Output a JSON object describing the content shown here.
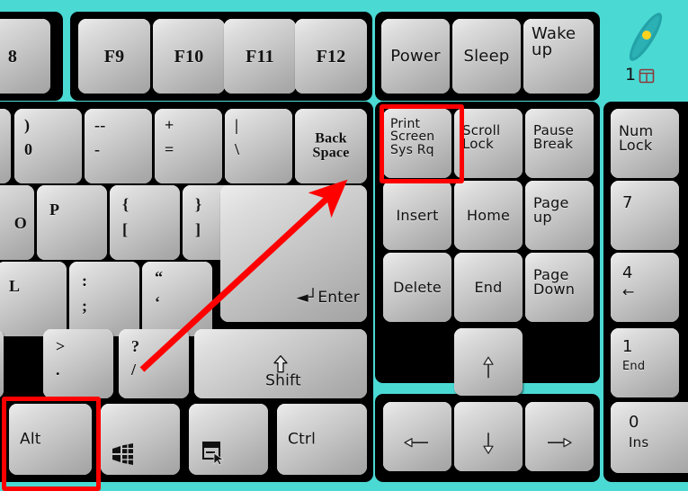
{
  "meta": {
    "subject": "computer keyboard right-hand portion",
    "background_color": "#4bd9d4",
    "bezel_color": "#000000",
    "key_face_color": "#c9c9c9",
    "highlight_color": "#ff0000",
    "arrow_color": "#ff0000"
  },
  "indicator": {
    "led_color": "#1f9aa0",
    "led_dot_color": "#ffd21f",
    "number": "1",
    "icon_name": "window-grid-icon",
    "icon_color": "#8c3a3a"
  },
  "function_row": [
    {
      "name": "f8-key",
      "label": "8",
      "partial": true
    },
    {
      "name": "f9-key",
      "label": "F9"
    },
    {
      "name": "f10-key",
      "label": "F10"
    },
    {
      "name": "f11-key",
      "label": "F11"
    },
    {
      "name": "f12-key",
      "label": "F12"
    }
  ],
  "power_row": [
    {
      "name": "power-key",
      "label": "Power"
    },
    {
      "name": "sleep-key",
      "label": "Sleep"
    },
    {
      "name": "wakeup-key",
      "label": "Wake\nup"
    }
  ],
  "number_row": [
    {
      "name": "zero-key",
      "upper": ")",
      "lower": "0"
    },
    {
      "name": "minus-key",
      "upper": "--",
      "lower": "-"
    },
    {
      "name": "equals-key",
      "upper": "+",
      "lower": "="
    },
    {
      "name": "backslash-key",
      "upper": "|",
      "lower": "\\"
    },
    {
      "name": "backspace-key",
      "label": "Back\nSpace"
    }
  ],
  "letter_row": [
    {
      "name": "o-key",
      "label": "O",
      "partial": true
    },
    {
      "name": "p-key",
      "label": "P"
    },
    {
      "name": "bracket-left-key",
      "upper": "{",
      "lower": "["
    },
    {
      "name": "bracket-right-key",
      "upper": "}",
      "lower": "]"
    }
  ],
  "home_row": [
    {
      "name": "l-key",
      "label": "L"
    },
    {
      "name": "semicolon-key",
      "upper": ":",
      "lower": ";"
    },
    {
      "name": "quote-key",
      "upper": "“",
      "lower": "‘"
    },
    {
      "name": "enter-key",
      "label": "Enter",
      "glyph": "◄┘"
    }
  ],
  "bottom_letter_row": [
    {
      "name": "m-key",
      "label": "",
      "partial": true
    },
    {
      "name": "period-key",
      "upper": ">",
      "lower": "."
    },
    {
      "name": "slash-key",
      "upper": "?",
      "lower": "/"
    },
    {
      "name": "right-shift-key",
      "label": "Shift",
      "glyph": "shift-arrow-icon"
    }
  ],
  "modifier_row": [
    {
      "name": "alt-key",
      "label": "Alt"
    },
    {
      "name": "windows-key",
      "label": "",
      "glyph": "windows-logo-icon"
    },
    {
      "name": "menu-key",
      "label": "",
      "glyph": "context-menu-icon"
    },
    {
      "name": "ctrl-key",
      "label": "Ctrl"
    }
  ],
  "nav_cluster": [
    {
      "name": "print-screen-key",
      "label": "Print\nScreen\nSys Rq"
    },
    {
      "name": "scroll-lock-key",
      "label": "Scroll\nLock"
    },
    {
      "name": "pause-break-key",
      "label": "Pause\nBreak"
    },
    {
      "name": "insert-key",
      "label": "Insert"
    },
    {
      "name": "home-key",
      "label": "Home"
    },
    {
      "name": "page-up-key",
      "label": "Page\nup"
    },
    {
      "name": "delete-key",
      "label": "Delete"
    },
    {
      "name": "end-key",
      "label": "End"
    },
    {
      "name": "page-down-key",
      "label": "Page\nDown"
    }
  ],
  "arrow_cluster": [
    {
      "name": "arrow-up-key",
      "glyph": "arrow-up-icon"
    },
    {
      "name": "arrow-left-key",
      "glyph": "arrow-left-icon"
    },
    {
      "name": "arrow-down-key",
      "glyph": "arrow-down-icon"
    },
    {
      "name": "arrow-right-key",
      "glyph": "arrow-right-icon"
    }
  ],
  "numpad": [
    {
      "name": "num-lock-key",
      "label": "Num\nLock"
    },
    {
      "name": "numpad-7-key",
      "label": "7"
    },
    {
      "name": "numpad-4-key",
      "label": "4",
      "sub": "←"
    },
    {
      "name": "numpad-1-key",
      "label": "1",
      "sub": "End"
    },
    {
      "name": "numpad-0-key",
      "label": "0",
      "sub": "Ins"
    }
  ],
  "annotations": {
    "highlight_boxes": [
      {
        "name": "alt-key-highlight",
        "target": "alt-key"
      },
      {
        "name": "print-screen-key-highlight",
        "target": "print-screen-key"
      }
    ],
    "arrow": {
      "name": "instruction-arrow",
      "from": "slash-key",
      "to": "enter-key",
      "direction": "up-right"
    }
  }
}
